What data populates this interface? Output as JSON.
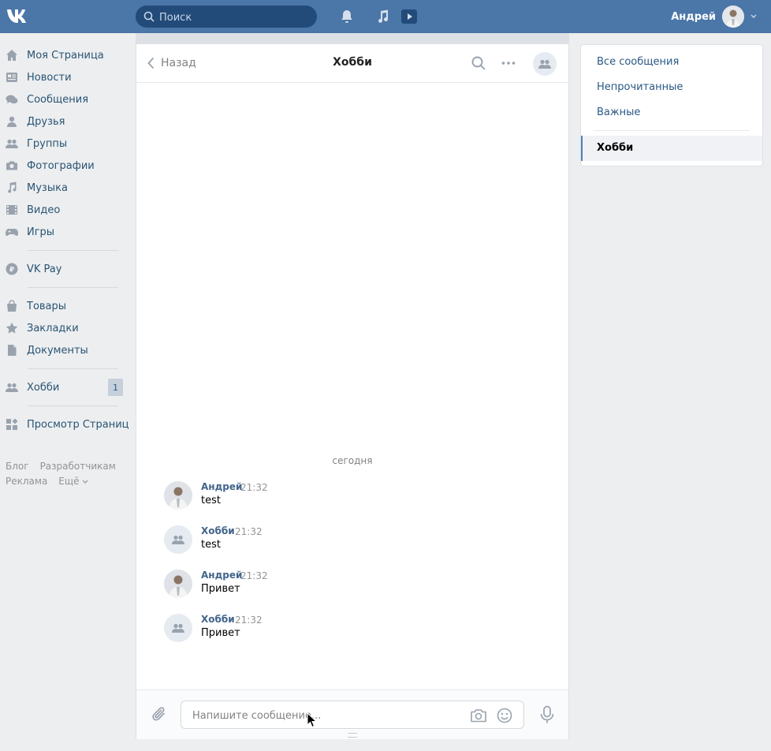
{
  "topbar": {
    "logo": "VK",
    "search_placeholder": "Поиск",
    "user_name": "Андрей"
  },
  "leftnav": {
    "items": [
      {
        "label": "Моя Страница",
        "icon": "home-icon"
      },
      {
        "label": "Новости",
        "icon": "news-icon"
      },
      {
        "label": "Сообщения",
        "icon": "messages-icon"
      },
      {
        "label": "Друзья",
        "icon": "friend-icon"
      },
      {
        "label": "Группы",
        "icon": "groups-icon"
      },
      {
        "label": "Фотографии",
        "icon": "camera-icon"
      },
      {
        "label": "Музыка",
        "icon": "music-icon"
      },
      {
        "label": "Видео",
        "icon": "video-icon"
      },
      {
        "label": "Игры",
        "icon": "gamepad-icon"
      }
    ],
    "pay": {
      "label": "VK Pay",
      "icon": "vkpay-icon"
    },
    "extra": [
      {
        "label": "Товары",
        "icon": "bag-icon"
      },
      {
        "label": "Закладки",
        "icon": "star-icon"
      },
      {
        "label": "Документы",
        "icon": "document-icon"
      }
    ],
    "group": {
      "label": "Хобби",
      "badge": "1"
    },
    "apps": {
      "label": "Просмотр Страниц"
    },
    "footer": {
      "blog": "Блог",
      "dev": "Разработчикам",
      "ads": "Реклама",
      "more": "Ещё"
    }
  },
  "chat": {
    "back_label": "Назад",
    "title": "Хобби",
    "date_separator": "сегодня",
    "messages": [
      {
        "author": "Андрей",
        "time": "21:32",
        "text": "test",
        "avatar": "user"
      },
      {
        "author": "Хобби",
        "time": "21:32",
        "text": "test",
        "avatar": "group"
      },
      {
        "author": "Андрей",
        "time": "21:32",
        "text": "Привет",
        "avatar": "user"
      },
      {
        "author": "Хобби",
        "time": "21:32",
        "text": "Привет",
        "avatar": "group"
      }
    ],
    "composer_placeholder": "Напишите сообщение..."
  },
  "folders": {
    "all": "Все сообщения",
    "unread": "Непрочитанные",
    "important": "Важные",
    "active": "Хобби"
  },
  "colors": {
    "header": "#4a76a8",
    "link": "#2a5885",
    "background": "#edeef0"
  }
}
